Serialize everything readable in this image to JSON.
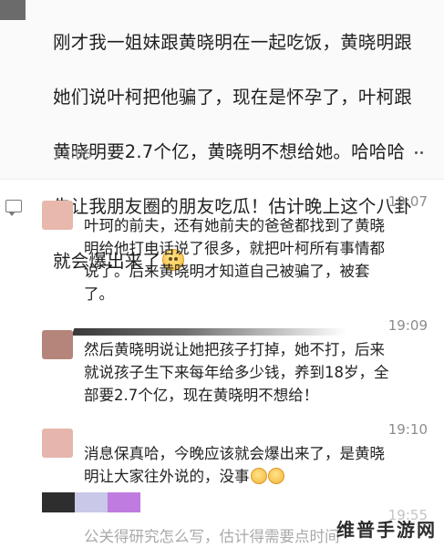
{
  "post": {
    "text_lines": [
      "刚才我一姐妹跟黄晓明在一起吃饭，黄晓明跟",
      "她们说叶柯把他骗了，现在是怀孕了，叶柯跟",
      "黄晓明要2.7个亿，黄晓明不想给她。哈哈哈",
      "先让我朋友圈的朋友吃瓜！估计晚上这个八卦",
      "就会爆出来了"
    ],
    "time": "19:03",
    "emoji_icon": "smiling-face-icon"
  },
  "comments": [
    {
      "time": "19:07",
      "avatar_color": "#e8b8ac",
      "text_lines": [
        "叶珂的前夫，还有她前夫的爸爸都找到了黄晓",
        "明给他打电话说了很多，就把叶柯所有事情都",
        "说了。后来黄晓明才知道自己被骗了，被套",
        "了。"
      ]
    },
    {
      "time": "19:09",
      "avatar_color": "#b5857c",
      "text_lines": [
        "然后黄晓明说让她把孩子打掉，她不打，后来",
        "就说孩子生下来每年给多少钱，养到18岁，全",
        "部要2.7个亿，现在黄晓明不想给！"
      ]
    },
    {
      "time": "19:10",
      "avatar_color": "#e6b5ad",
      "text_lines": [
        "消息保真哈，今晚应该就会爆出来了，是黄晓",
        "明让大家往外说的，没事"
      ]
    },
    {
      "time": "19:55",
      "text_lines": [
        "公关得研究怎么写，估计得需要点时间"
      ]
    }
  ],
  "watermark": "维普手游网",
  "icons": [
    "more-options-icon",
    "comment-icon",
    "smiling-face-icon",
    "grinning-face-icon"
  ]
}
